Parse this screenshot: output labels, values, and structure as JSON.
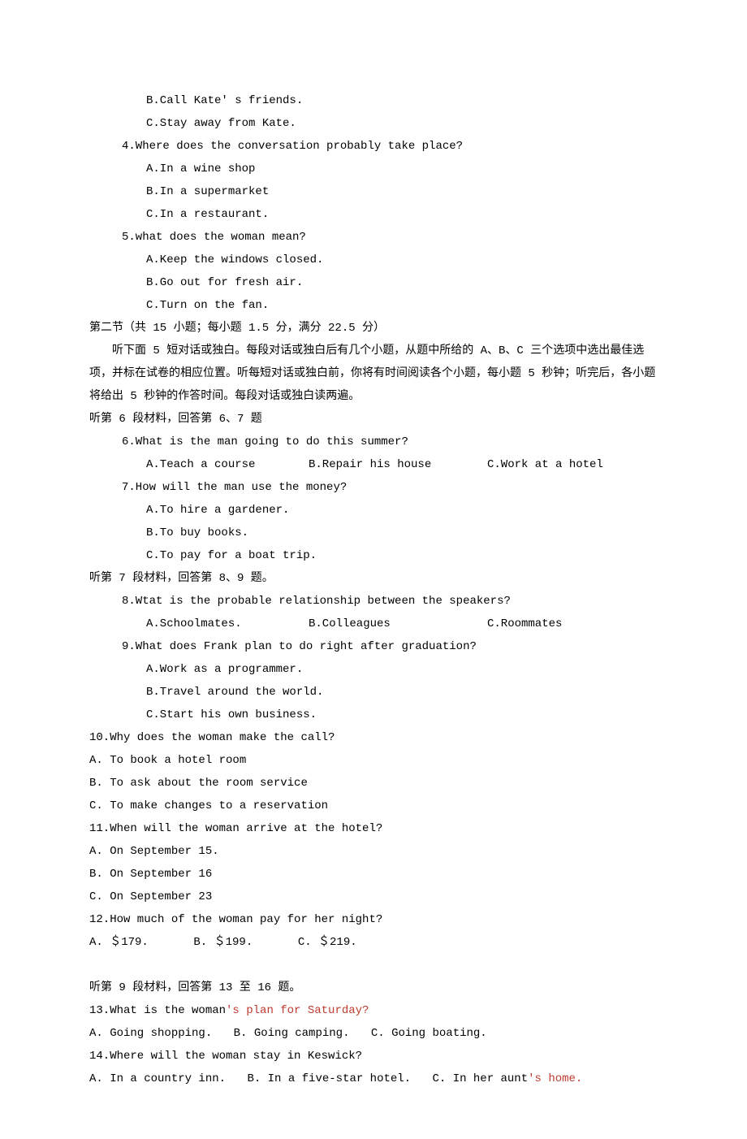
{
  "top": {
    "optB": "B.Call Kate' s friends.",
    "optC": "C.Stay away from Kate."
  },
  "q4": {
    "text": "4.Where does the conversation probably take place?",
    "A": "A.In a wine shop",
    "B": "B.In a supermarket",
    "C": "C.In a restaurant."
  },
  "q5": {
    "text": "5.what does the woman mean?",
    "A": "A.Keep the windows closed.",
    "B": "B.Go out for fresh air.",
    "C": "C.Turn on the fan."
  },
  "section2": {
    "title": "第二节（共 15 小题；每小题 1.5 分，满分 22.5 分）",
    "instr": "听下面 5 短对话或独白。每段对话或独白后有几个小题，从题中所给的 A、B、C 三个选项中选出最佳选项，并标在试卷的相应位置。听每短对话或独白前，你将有时间阅读各个小题，每小题 5 秒钟；听完后，各小题将给出 5 秒钟的作答时间。每段对话或独白读两遍。"
  },
  "mat6": "听第 6 段材料，回答第 6、7 题",
  "q6": {
    "text": "6.What is the man going to do this summer?",
    "A": "A.Teach a course",
    "B": "B.Repair his house",
    "C": "C.Work at a hotel"
  },
  "q7": {
    "text": "7.How will the man use the money?",
    "A": "A.To hire a gardener.",
    "B": "B.To buy books.",
    "C": "C.To pay for a boat trip."
  },
  "mat7": "听第 7 段材料，回答第 8、9 题。",
  "q8": {
    "text": "8.Wtat is the probable relationship between the speakers?",
    "A": "A.Schoolmates.",
    "B": "B.Colleagues",
    "C": "C.Roommates"
  },
  "q9": {
    "text": "9.What does Frank plan to do right after graduation?",
    "A": "A.Work as a programmer.",
    "B": "B.Travel around the world.",
    "C": "C.Start his own business."
  },
  "q10": {
    "text": "10.Why does the woman make the call?",
    "A": "A. To book a hotel room",
    "B": "B. To ask about the room service",
    "C": "C. To make changes to a reservation"
  },
  "q11": {
    "text": "11.When will the woman arrive at the hotel?",
    "A": "A. On September 15.",
    "B": "B. On September 16",
    "C": "C. On September 23"
  },
  "q12": {
    "text": "12.How much of the woman pay for her night?",
    "A": "A. ＄179.",
    "B": "B. ＄199.",
    "C": "C. ＄219."
  },
  "mat9": "听第 9 段材料，回答第 13 至 16 题。",
  "q13": {
    "pre": "13.What  is the woman",
    "suf": "'s plan for Saturday?",
    "A": "A. Going shopping.",
    "B": "B. Going camping.",
    "C": "C. Going boating."
  },
  "q14": {
    "text": "14.Where will the woman stay in Keswick?",
    "A": "A. In a country inn.",
    "B": "B. In a five-star hotel.",
    "Cpre": "C. In her aunt",
    "Csuf": "'s home."
  }
}
